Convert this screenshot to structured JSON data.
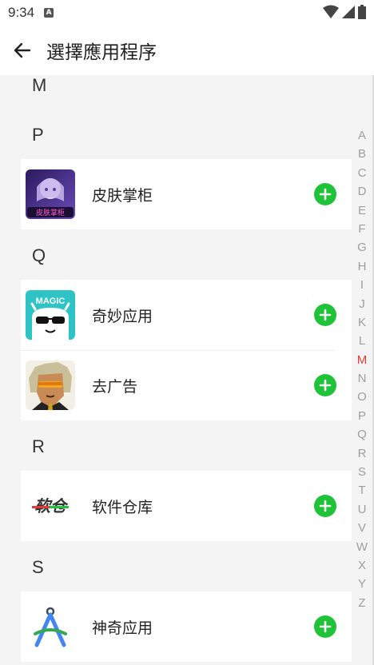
{
  "status": {
    "time": "9:34",
    "notification_glyph": "A"
  },
  "appbar": {
    "title": "選擇應用程序"
  },
  "sections": [
    {
      "letter": "M"
    },
    {
      "letter": "P",
      "items": [
        {
          "name": "皮肤掌柜",
          "icon": "skin-manager-icon",
          "icon_text": "皮肤掌柜"
        }
      ]
    },
    {
      "letter": "Q",
      "items": [
        {
          "name": "奇妙应用",
          "icon": "magic-app-icon",
          "icon_text": "MAGIC"
        },
        {
          "name": "去广告",
          "icon": "ad-remover-icon"
        }
      ]
    },
    {
      "letter": "R",
      "items": [
        {
          "name": "软件仓库",
          "icon": "software-repo-icon",
          "icon_text": "软仓"
        }
      ]
    },
    {
      "letter": "S",
      "items": [
        {
          "name": "神奇应用",
          "icon": "compass-app-icon"
        }
      ]
    }
  ],
  "index_bar": {
    "letters": [
      "A",
      "B",
      "C",
      "D",
      "E",
      "F",
      "G",
      "H",
      "I",
      "J",
      "K",
      "L",
      "M",
      "N",
      "O",
      "P",
      "Q",
      "R",
      "S",
      "T",
      "U",
      "V",
      "W",
      "X",
      "Y",
      "Z"
    ],
    "active": "M",
    "active_color": "#e53935",
    "inactive_color": "#9e9e9e"
  },
  "colors": {
    "add_button": "#1ec337",
    "background": "#f4f4f4"
  }
}
